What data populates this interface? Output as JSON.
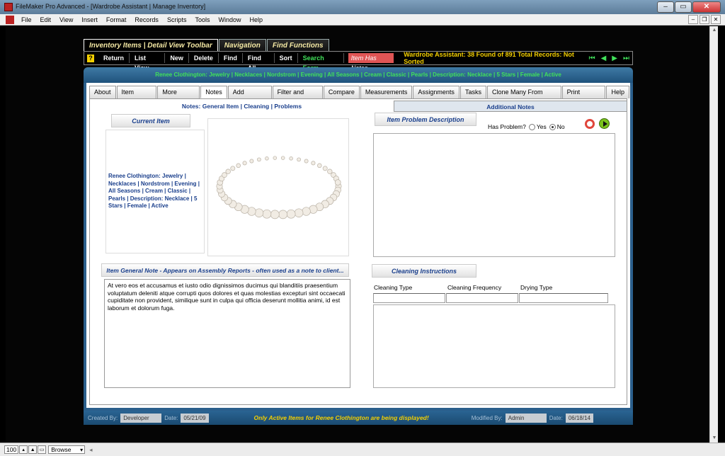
{
  "window": {
    "title": "FileMaker Pro Advanced - [Wardrobe Assistant | Manage Inventory]"
  },
  "menu": [
    "File",
    "Edit",
    "View",
    "Insert",
    "Format",
    "Records",
    "Scripts",
    "Tools",
    "Window",
    "Help"
  ],
  "top_tabs": [
    "Inventory Items | Detail View Toolbar",
    "Navigation",
    "Find Functions"
  ],
  "toolbar": {
    "buttons": [
      "Return",
      "List View",
      "New",
      "Delete",
      "Find",
      "Find All",
      "Sort"
    ],
    "search_form": "Search Form",
    "problem_badge": "Item Has Notes",
    "status": "Wardrobe Assistant:  38 Found of 891 Total Records: Not Sorted"
  },
  "header_line": "Renee Clothington: Jewelry | Necklaces | Nordstrom | Evening | All Seasons | Cream | Classic | Pearls | Description: Necklace | 5 Stars | Female | Active",
  "section_tabs": [
    "About",
    "Item Detail",
    "More Detail",
    "Notes",
    "Add Images",
    "Filter and Flag",
    "Compare",
    "Measurements",
    "Assignments",
    "Tasks",
    "Clone Many From One",
    "Print Center",
    "Help"
  ],
  "active_section": "Notes",
  "subtabs": {
    "left": "Notes:  General Item | Cleaning | Problems",
    "right": "Additional Notes"
  },
  "current_item": {
    "label": "Current Item",
    "description": "Renee Clothington: Jewelry | Necklaces | Nordstrom | Evening | All Seasons | Cream | Classic | Pearls | Description: Necklace | 5 Stars | Female | Active"
  },
  "problem": {
    "label": "Item Problem Description",
    "has_problem_label": "Has Problem?",
    "yes": "Yes",
    "no": "No",
    "selected": "No"
  },
  "general_note": {
    "label": "Item General Note - Appears on Assembly Reports - often used as a note to client...",
    "text": "At vero eos et accusamus et iusto odio dignissimos ducimus qui blanditiis praesentium voluptatum deleniti atque corrupti quos dolores et quas molestias excepturi sint occaecati cupiditate non provident, similique sunt in culpa qui officia deserunt mollitia animi, id est laborum et dolorum fuga."
  },
  "cleaning": {
    "label": "Cleaning Instructions",
    "columns": [
      "Cleaning Type",
      "Cleaning Frequency",
      "Drying Type"
    ]
  },
  "footer": {
    "created_by_label": "Created By:",
    "created_by": "Developer",
    "date_label": "Date:",
    "created_date": "05/21/09",
    "message": "Only Active Items for Renee Clothington are being displayed!",
    "modified_by_label": "Modified By:",
    "modified_by": "Admin",
    "modified_date": "06/18/14"
  },
  "status": {
    "zoom": "100",
    "mode": "Browse"
  }
}
